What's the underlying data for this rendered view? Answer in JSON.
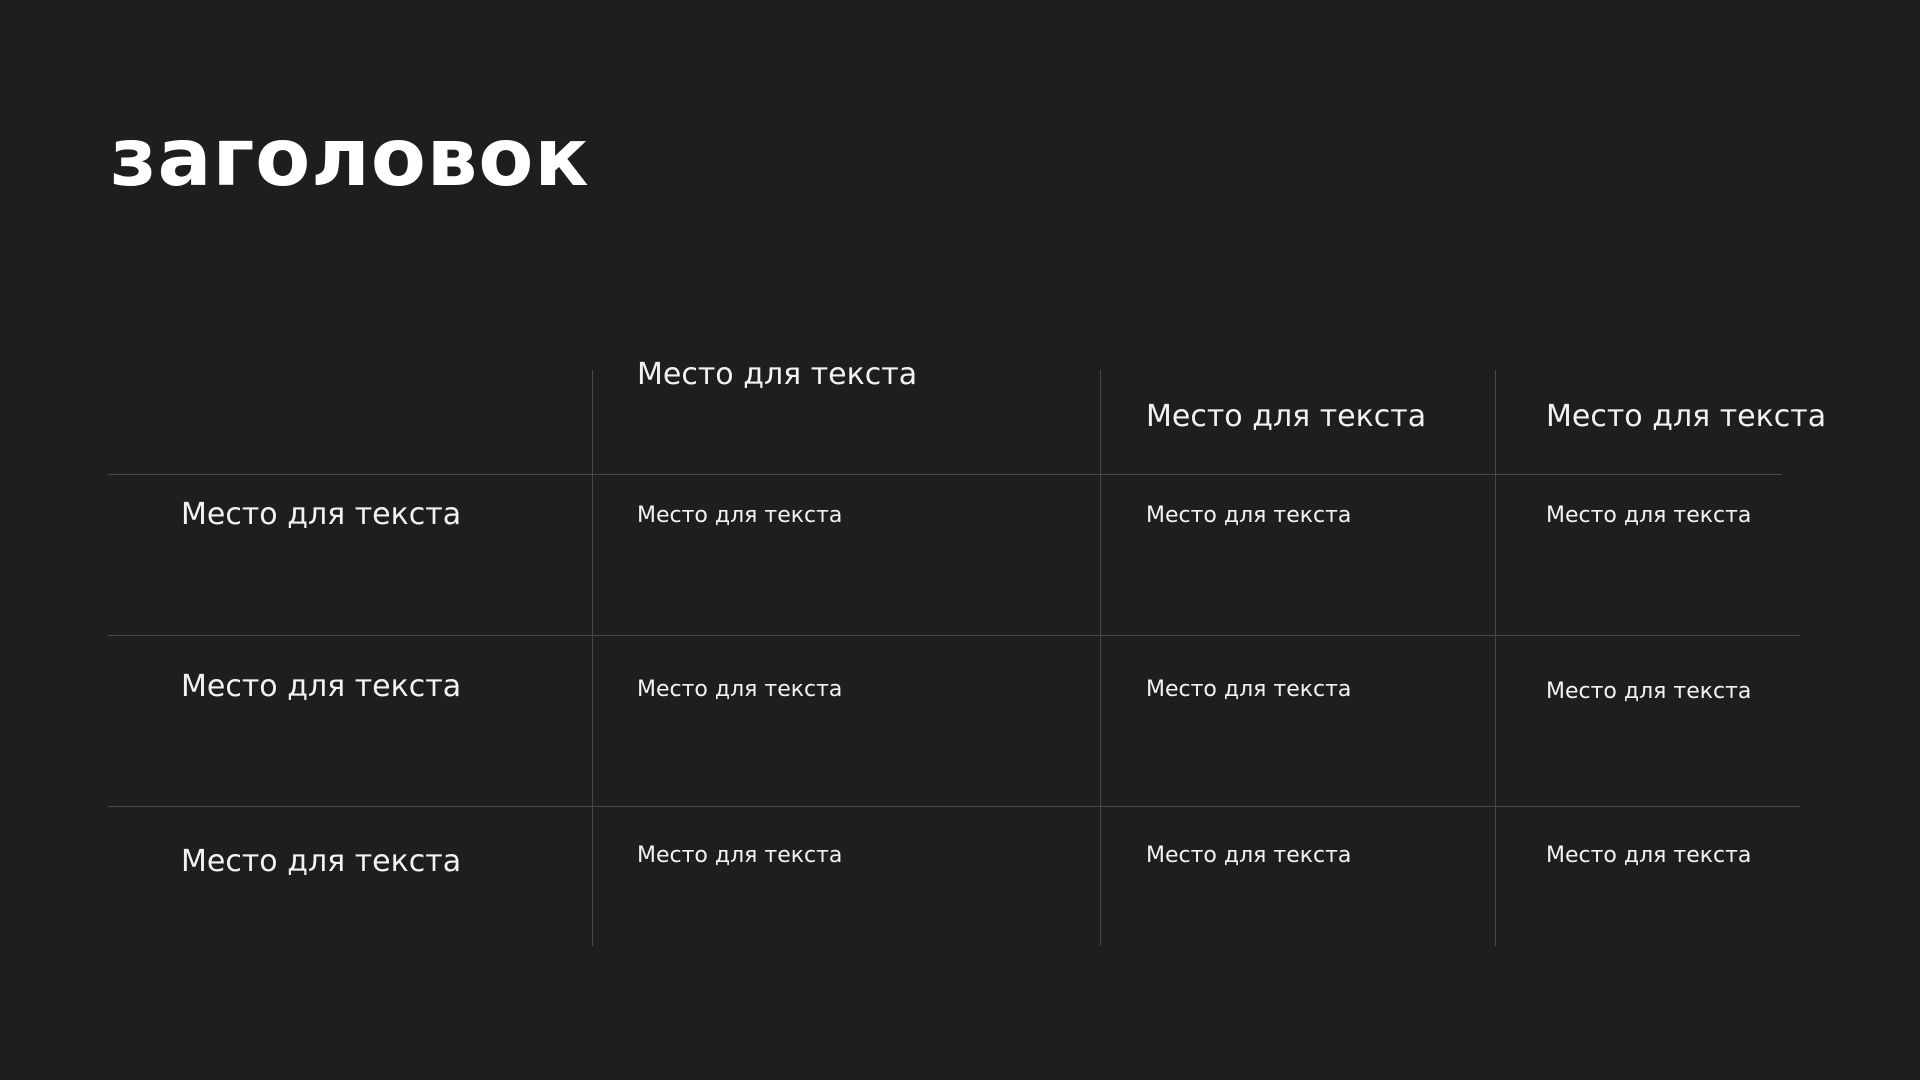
{
  "title": "заголовок",
  "table": {
    "column_headers": [
      "Место для текста",
      "Место для текста",
      "Место для текста"
    ],
    "rows": [
      {
        "header": "Место для текста",
        "cells": [
          "Место для текста",
          "Место для текста",
          "Место для текста"
        ]
      },
      {
        "header": "Место для текста",
        "cells": [
          "Место для текста",
          "Место для текста",
          "Место для текста"
        ]
      },
      {
        "header": "Место для текста",
        "cells": [
          "Место для текста",
          "Место для текста",
          "Место для текста"
        ]
      }
    ]
  }
}
